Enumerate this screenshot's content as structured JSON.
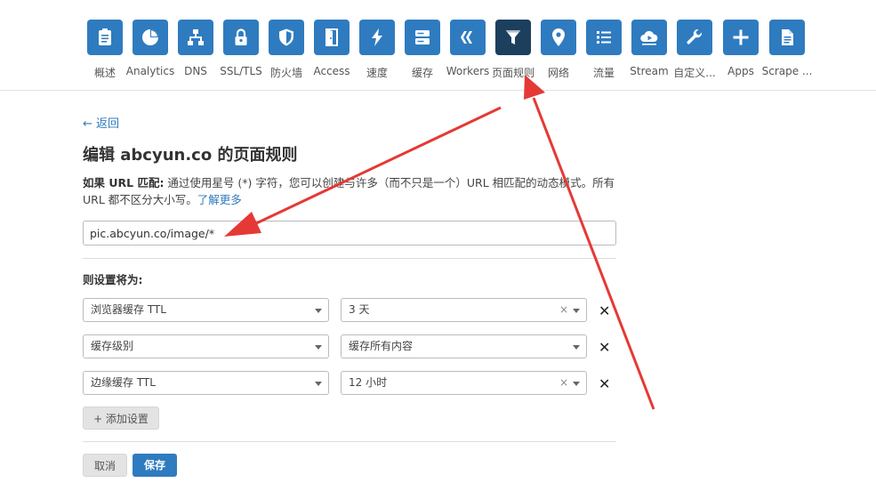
{
  "nav": {
    "items": [
      {
        "label": "概述",
        "icon": "clipboard-icon",
        "active": false
      },
      {
        "label": "Analytics",
        "icon": "pie-chart-icon",
        "active": false
      },
      {
        "label": "DNS",
        "icon": "network-icon",
        "active": false
      },
      {
        "label": "SSL/TLS",
        "icon": "lock-icon",
        "active": false
      },
      {
        "label": "防火墙",
        "icon": "shield-icon",
        "active": false
      },
      {
        "label": "Access",
        "icon": "door-icon",
        "active": false
      },
      {
        "label": "速度",
        "icon": "lightning-icon",
        "active": false
      },
      {
        "label": "缓存",
        "icon": "server-icon",
        "active": false
      },
      {
        "label": "Workers",
        "icon": "workers-icon",
        "active": false
      },
      {
        "label": "页面规则",
        "icon": "filter-icon",
        "active": true
      },
      {
        "label": "网络",
        "icon": "location-pin-icon",
        "active": false
      },
      {
        "label": "流量",
        "icon": "list-icon",
        "active": false
      },
      {
        "label": "Stream",
        "icon": "cloud-play-icon",
        "active": false
      },
      {
        "label": "自定义...",
        "icon": "wrench-icon",
        "active": false
      },
      {
        "label": "Apps",
        "icon": "plus-icon",
        "active": false
      },
      {
        "label": "Scrape ...",
        "icon": "document-icon",
        "active": false
      }
    ]
  },
  "page": {
    "back_label": "← 返回",
    "title": "编辑 abcyun.co 的页面规则",
    "desc_label": "如果 URL 匹配:",
    "desc_text": " 通过使用星号 (*) 字符，您可以创建与许多（而不只是一个）URL 相匹配的动态模式。所有 URL 都不区分大小写。",
    "learn_more": "了解更多",
    "url_value": "pic.abcyun.co/image/*",
    "settings_label": "则设置将为:",
    "settings": [
      {
        "setting": "浏览器缓存 TTL",
        "value": "3 天",
        "clearable": true
      },
      {
        "setting": "缓存级别",
        "value": "缓存所有内容",
        "clearable": false
      },
      {
        "setting": "边缘缓存 TTL",
        "value": "12 小时",
        "clearable": true
      }
    ],
    "add_setting_label": "+ 添加设置",
    "cancel_label": "取消",
    "save_label": "保存"
  },
  "colors": {
    "tile": "#2f7bbf",
    "tile_active": "#1d3f5e",
    "link": "#2f7bbf",
    "annotation_arrow": "#e53935"
  }
}
